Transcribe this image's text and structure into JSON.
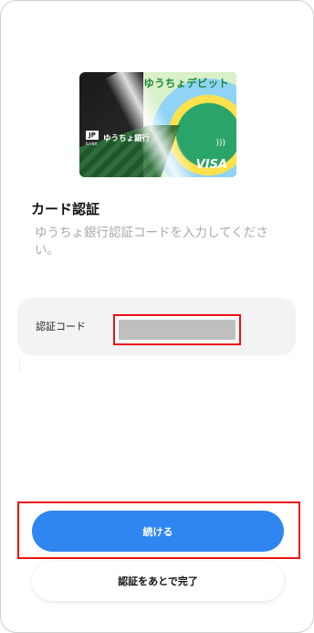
{
  "card": {
    "title": "ゆうちょデビット",
    "bank_name": "ゆうちょ銀行",
    "logo_mark": "JP",
    "logo_sub": "BANK",
    "network": "VISA",
    "contactless_icon": "contactless-icon"
  },
  "page": {
    "heading": "カード認証",
    "description": "ゆうちょ銀行認証コードを入力してください。"
  },
  "form": {
    "code_label": "認証コード",
    "code_value": ""
  },
  "buttons": {
    "continue_label": "続ける",
    "later_label": "認証をあとで完了"
  },
  "colors": {
    "primary": "#2f86f0",
    "highlight": "#e11111"
  }
}
